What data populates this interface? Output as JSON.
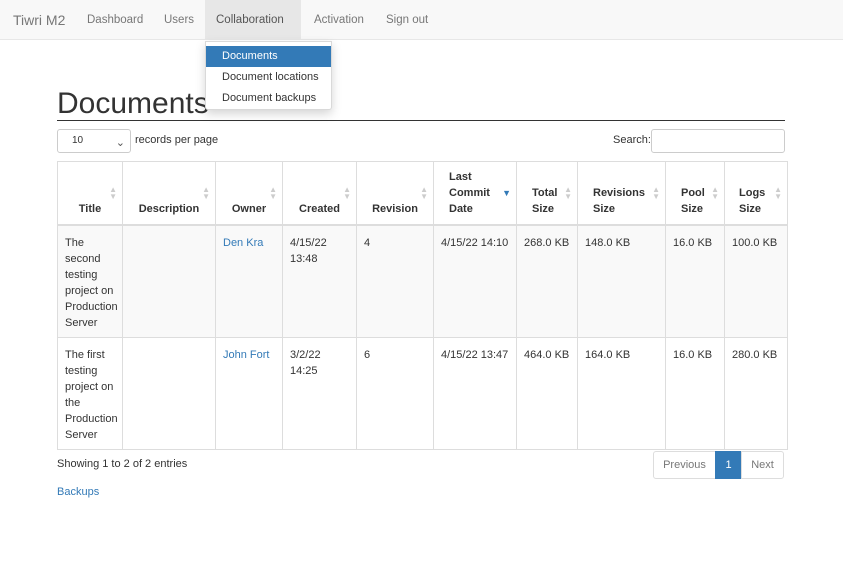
{
  "navbar": {
    "brand": "Tiwri M2",
    "items": [
      {
        "label": "Dashboard"
      },
      {
        "label": "Users"
      },
      {
        "label": "Collaboration"
      },
      {
        "label": "Activation"
      },
      {
        "label": "Sign out"
      }
    ],
    "dropdown": [
      {
        "label": "Documents"
      },
      {
        "label": "Document locations"
      },
      {
        "label": "Document backups"
      }
    ]
  },
  "page": {
    "title": "Documents",
    "length_value": "10",
    "length_label": "records per page",
    "search_label": "Search:",
    "search_placeholder": ""
  },
  "table": {
    "columns": [
      {
        "label": "Title"
      },
      {
        "label": "Description"
      },
      {
        "label": "Owner"
      },
      {
        "label": "Created"
      },
      {
        "label": "Revision"
      },
      {
        "label": "Last Commit Date"
      },
      {
        "label": "Total Size"
      },
      {
        "label": "Revisions Size"
      },
      {
        "label": "Pool Size"
      },
      {
        "label": "Logs Size"
      }
    ],
    "sort_column": "Last Commit Date",
    "rows": [
      {
        "title": "The second testing project on Production Server",
        "description": "",
        "owner": "Den Kra",
        "created": "4/15/22 13:48",
        "revision": "4",
        "last_commit": "4/15/22 14:10",
        "total_size": "268.0 KB",
        "revisions_size": "148.0 KB",
        "pool_size": "16.0 KB",
        "logs_size": "100.0 KB"
      },
      {
        "title": "The first testing project on the Production Server",
        "description": "",
        "owner": "John Fort",
        "created": "3/2/22 14:25",
        "revision": "6",
        "last_commit": "4/15/22 13:47",
        "total_size": "464.0 KB",
        "revisions_size": "164.0 KB",
        "pool_size": "16.0 KB",
        "logs_size": "280.0 KB"
      }
    ]
  },
  "footer": {
    "info": "Showing 1 to 2 of 2 entries",
    "prev": "Previous",
    "current_page": "1",
    "next": "Next",
    "backups_link": "Backups"
  },
  "colors": {
    "accent": "#337ab7",
    "navbar_bg": "#f8f8f8",
    "active_nav_bg": "#e7e7e7"
  }
}
